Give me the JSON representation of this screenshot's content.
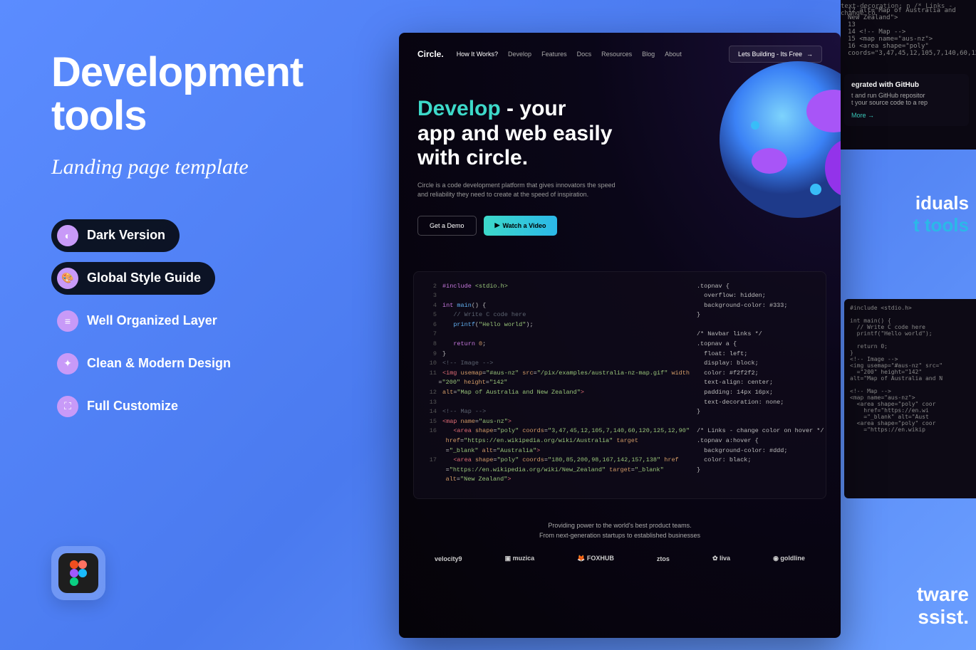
{
  "left": {
    "title_line1": "Development",
    "title_line2": "tools",
    "subtitle": "Landing page template",
    "features": [
      {
        "label": "Dark Version"
      },
      {
        "label": "Global Style Guide"
      },
      {
        "label": "Well Organized Layer"
      },
      {
        "label": "Clean & Modern Design"
      },
      {
        "label": "Full Customize"
      }
    ]
  },
  "preview": {
    "logo": "Circle.",
    "nav": [
      "How It Works?",
      "Develop",
      "Features",
      "Docs",
      "Resources",
      "Blog",
      "About"
    ],
    "cta": "Lets Building - Its Free",
    "hero": {
      "accent": "Develop",
      "rest1": " - your",
      "rest2": "app and web easily with circle.",
      "sub": "Circle is a code development platform that gives innovators the speed and reliability they need to create at the speed of inspiration.",
      "btn1": "Get a Demo",
      "btn2": "Watch a Video"
    },
    "code_left_lines": [
      {
        "n": "2",
        "html": "<span class='kw'>#include</span> <span class='str'>&lt;stdio.h&gt;</span>"
      },
      {
        "n": "3",
        "html": ""
      },
      {
        "n": "4",
        "html": "<span class='kw'>int</span> <span class='fn'>main</span>() {"
      },
      {
        "n": "5",
        "html": "   <span class='cmt'>// Write C code here</span>"
      },
      {
        "n": "6",
        "html": "   <span class='fn'>printf</span>(<span class='str'>\"Hello world\"</span>);"
      },
      {
        "n": "7",
        "html": ""
      },
      {
        "n": "8",
        "html": "   <span class='kw'>return</span> <span class='num'>0</span>;"
      },
      {
        "n": "9",
        "html": "}"
      },
      {
        "n": "10",
        "html": "<span class='cmt'>&lt;!-- Image --&gt;</span>"
      },
      {
        "n": "11",
        "html": "<span class='tag'>&lt;img</span> <span class='attr'>usemap</span>=<span class='str'>\"#aus-nz\"</span> <span class='attr'>src</span>=<span class='str'>\"/pix/examples/australia-nz-map.gif\"</span> <span class='attr'>width</span>\n    =<span class='str'>\"200\"</span> <span class='attr'>height</span>=<span class='str'>\"142\"</span>"
      },
      {
        "n": "12",
        "html": "<span class='attr'>alt</span>=<span class='str'>\"Map of Australia and New Zealand\"</span><span class='tag'>&gt;</span>"
      },
      {
        "n": "13",
        "html": ""
      },
      {
        "n": "14",
        "html": "<span class='cmt'>&lt;!-- Map --&gt;</span>"
      },
      {
        "n": "15",
        "html": "<span class='tag'>&lt;map</span> <span class='attr'>name</span>=<span class='str'>\"aus-nz\"</span><span class='tag'>&gt;</span>"
      },
      {
        "n": "16",
        "html": "   <span class='tag'>&lt;area</span> <span class='attr'>shape</span>=<span class='str'>\"poly\"</span> <span class='attr'>coords</span>=<span class='str'>\"3,47,45,12,105,7,140,60,120,125,12,90\"</span>\n      <span class='attr'>href</span>=<span class='str'>\"https://en.wikipedia.org/wiki/Australia\"</span> <span class='attr'>target</span>\n      =<span class='str'>\"_blank\"</span> <span class='attr'>alt</span>=<span class='str'>\"Australia\"</span><span class='tag'>&gt;</span>"
      },
      {
        "n": "17",
        "html": "   <span class='tag'>&lt;area</span> <span class='attr'>shape</span>=<span class='str'>\"poly\"</span> <span class='attr'>coords</span>=<span class='str'>\"180,85,200,98,167,142,157,138\"</span> <span class='attr'>href</span>\n      =<span class='str'>\"https://en.wikipedia.org/wiki/New_Zealand\"</span> <span class='attr'>target</span>=<span class='str'>\"_blank\"</span>\n      <span class='attr'>alt</span>=<span class='str'>\"New Zealand\"</span><span class='tag'>&gt;</span>"
      }
    ],
    "code_right": ".topnav {\n  overflow: hidden;\n  background-color: #333;\n}\n\n/* Navbar links */\n.topnav a {\n  float: left;\n  display: block;\n  color: #f2f2f2;\n  text-align: center;\n  padding: 14px 16px;\n  text-decoration: none;\n}\n\n/* Links - change color on hover */\n.topnav a:hover {\n  background-color: #ddd;\n  color: black;\n}",
    "footer_line1": "Providing power to the world's best product teams.",
    "footer_line2": "From next-generation startups to established businesses",
    "logos": [
      "velocity9",
      "muzica",
      "FOXHUB",
      "ztos",
      "liva",
      "goldline"
    ]
  },
  "peek": {
    "top_code_lines": [
      "12  alt=\"Map of Australia and New Zealand\">",
      "13",
      "14  <!-- Map -->",
      "15  <map name=\"aus-nz\">",
      "16     <area shape=\"poly\" coords=\"3,47,45,12,105,7,140,60,120,125,12,90\""
    ],
    "top_css": "text-decoration: n\n\n/* Links - change co",
    "github_title": "egrated with GitHub",
    "github_sub": "t and run GitHub repositor\nt your source code to a rep",
    "github_more": "More →",
    "mid_line1": "iduals",
    "mid_line2": "t tools",
    "code2": "#include <stdio.h>\n\nint main() {\n  // Write C code here\n  printf(\"Hello world\");\n\n  return 0;\n}\n<!-- Image -->\n<img usemap=\"#aus-nz\" src=\"\n  =\"200\" height=\"142\"\nalt=\"Map of Australia and N\n\n<!-- Map -->\n<map name=\"aus-nz\">\n  <area shape=\"poly\" coor\n    href=\"https://en.wi\n    =\"_blank\" alt=\"Aust\n  <area shape=\"poly\" coor\n    =\"https://en.wikip",
    "bottom_line1": "tware",
    "bottom_line2": "ssist."
  }
}
